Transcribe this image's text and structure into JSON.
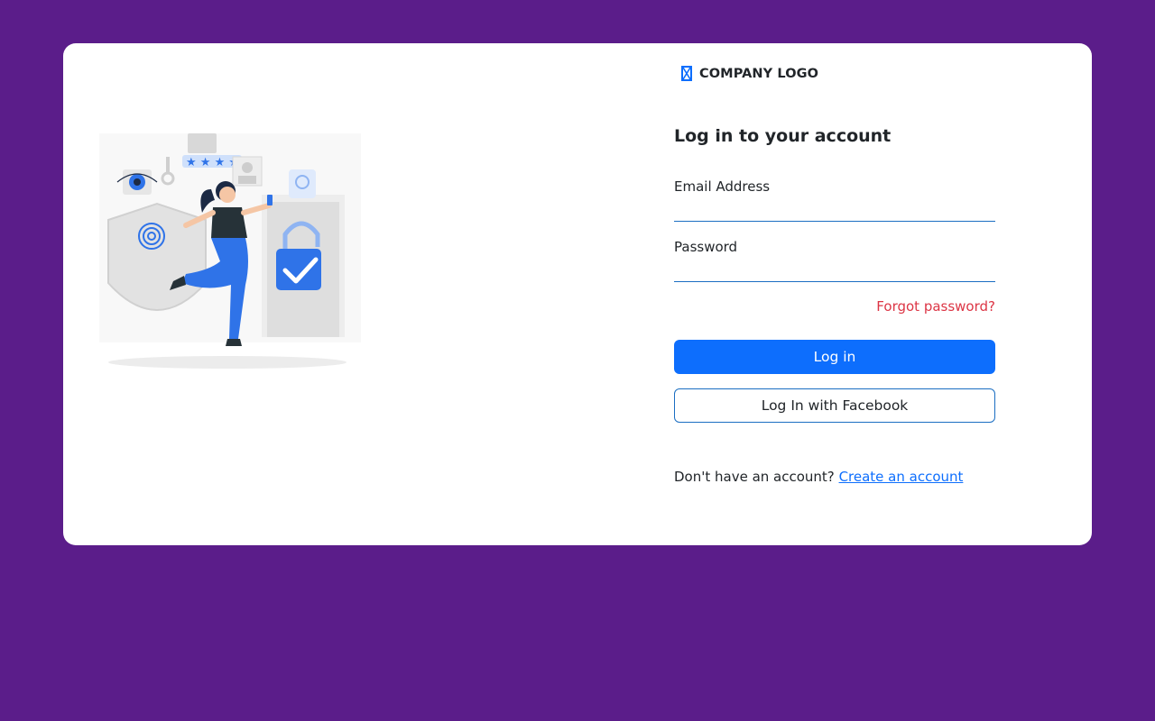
{
  "logo": {
    "text": "COMPANY LOGO",
    "icon": "hourglass-icon"
  },
  "form": {
    "heading": "Log in to your account",
    "email": {
      "label": "Email Address",
      "value": "",
      "placeholder": ""
    },
    "password": {
      "label": "Password",
      "value": "",
      "placeholder": ""
    },
    "forgot_password": "Forgot password?",
    "login_button": "Log in",
    "facebook_button": "Log In with Facebook",
    "signup_prompt": "Don't have an account?",
    "signup_link": "Create an account"
  },
  "colors": {
    "page_background": "#5b1d8a",
    "card_background": "#ffffff",
    "primary": "#0d6efd",
    "danger": "#dc3545",
    "input_border": "#1b6ec2"
  }
}
